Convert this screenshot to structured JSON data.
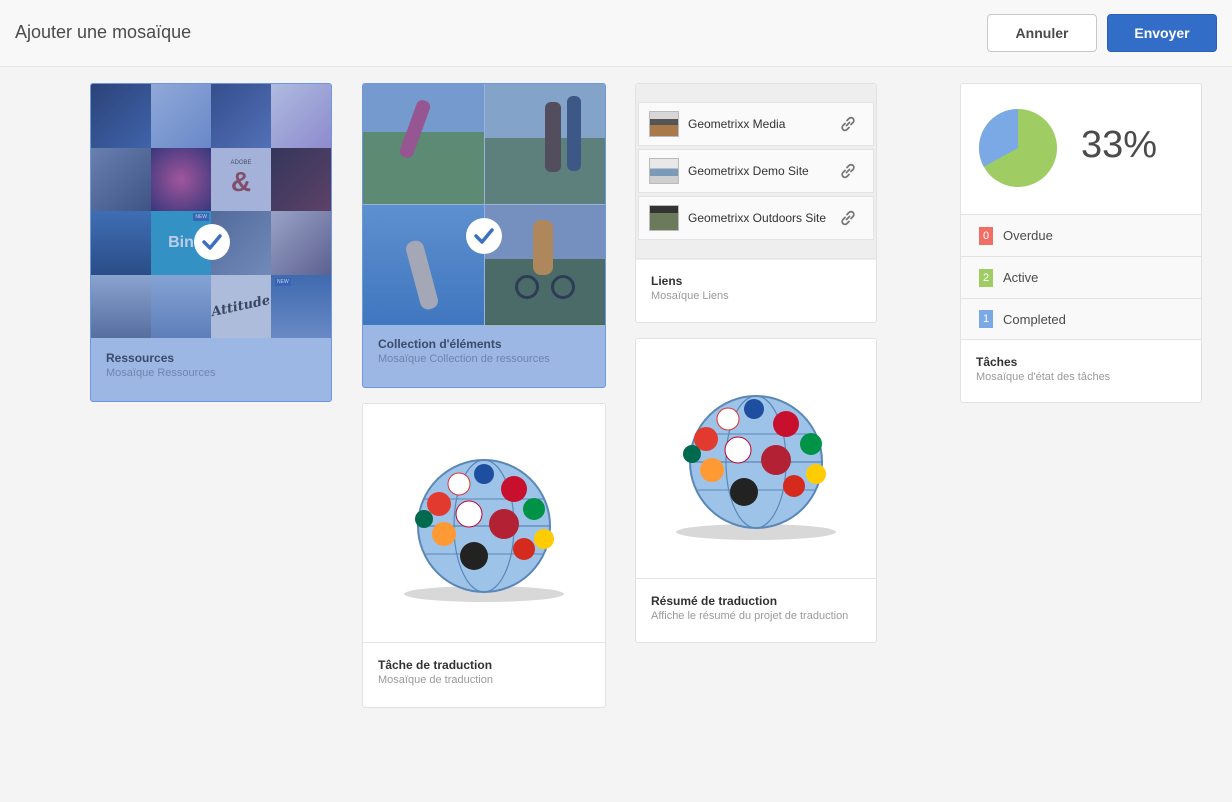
{
  "header": {
    "title": "Ajouter une mosaïque",
    "cancel_label": "Annuler",
    "submit_label": "Envoyer"
  },
  "tiles": {
    "resources": {
      "title": "Ressources",
      "subtitle": "Mosaïque Ressources",
      "selected": true,
      "badge_new": "NEW",
      "thumb_texts": [
        "ADOBE",
        "Bin",
        "Attitude",
        "NEW"
      ]
    },
    "collection": {
      "title": "Collection d'éléments",
      "subtitle": "Mosaïque Collection de ressources",
      "selected": true
    },
    "translation_task": {
      "title": "Tâche de traduction",
      "subtitle": "Mosaïque de traduction"
    },
    "links": {
      "title": "Liens",
      "subtitle": "Mosaïque Liens",
      "items": [
        {
          "label": "Geometrixx Media"
        },
        {
          "label": "Geometrixx Demo Site"
        },
        {
          "label": "Geometrixx Outdoors Site"
        }
      ]
    },
    "translation_summary": {
      "title": "Résumé de traduction",
      "subtitle": "Affiche le résumé du projet de traduction"
    },
    "tasks": {
      "title": "Tâches",
      "subtitle": "Mosaïque d'état des tâches",
      "percent": "33%",
      "percent_value": 0.33,
      "rows": [
        {
          "count": "0",
          "label": "Overdue",
          "color": "#f06e64"
        },
        {
          "count": "2",
          "label": "Active",
          "color": "#9fcd64"
        },
        {
          "count": "1",
          "label": "Completed",
          "color": "#7aa9e6"
        }
      ]
    }
  },
  "colors": {
    "accent": "#326ec8",
    "selected_bg": "#9db7e5",
    "pie_main": "#9fcd64",
    "pie_slice": "#7aa9e6"
  }
}
